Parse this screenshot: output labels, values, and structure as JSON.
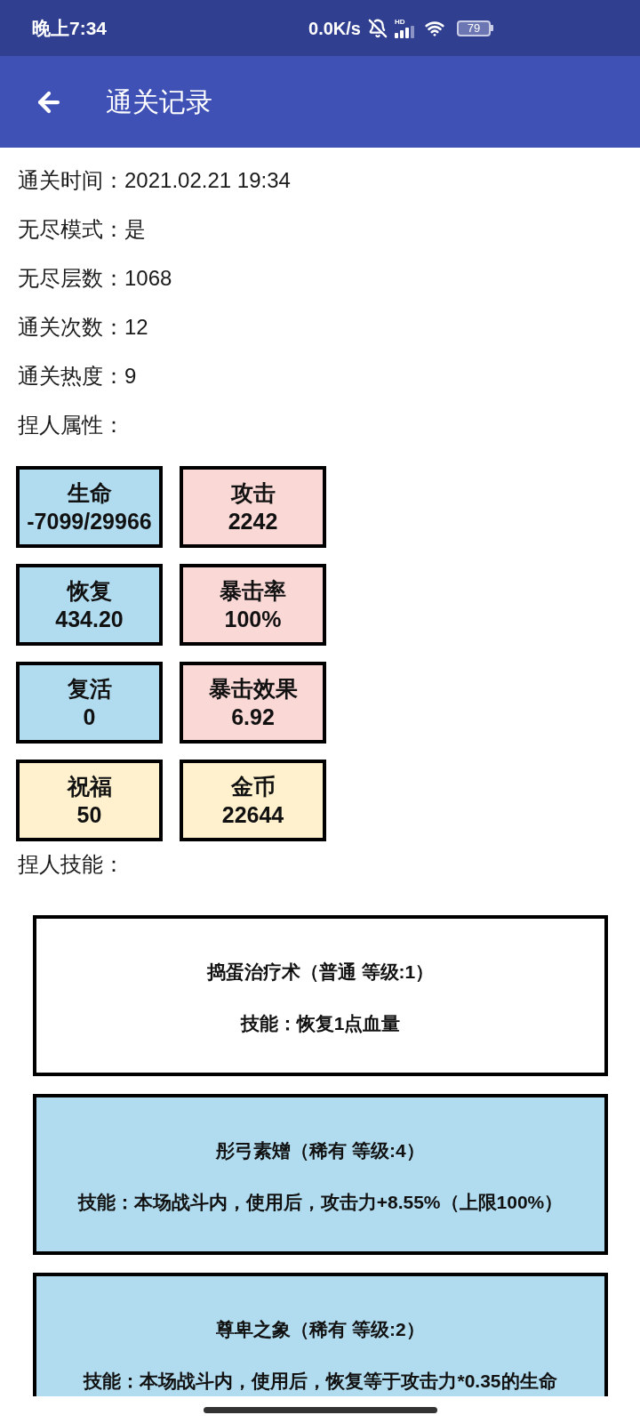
{
  "status_bar": {
    "time": "晚上7:34",
    "net_speed": "0.0K/s",
    "signal_label": "HD",
    "battery": "79"
  },
  "app_bar": {
    "title": "通关记录"
  },
  "records": [
    "通关时间：2021.02.21 19:34",
    "无尽模式：是",
    "无尽层数：1068",
    "通关次数：12",
    "通关热度：9"
  ],
  "attributes": {
    "heading": "捏人属性：",
    "tiles": [
      {
        "label": "生命",
        "value": "-7099/29966",
        "color": "#b1dcef"
      },
      {
        "label": "攻击",
        "value": "2242",
        "color": "#f9d8d6"
      },
      {
        "label": "恢复",
        "value": "434.20",
        "color": "#b1dcef"
      },
      {
        "label": "暴击率",
        "value": "100%",
        "color": "#f9d8d6"
      },
      {
        "label": "复活",
        "value": "0",
        "color": "#b1dcef"
      },
      {
        "label": "暴击效果",
        "value": "6.92",
        "color": "#f9d8d6"
      },
      {
        "label": "祝福",
        "value": "50",
        "color": "#fff1cd"
      },
      {
        "label": "金币",
        "value": "22644",
        "color": "#fff1cd"
      }
    ]
  },
  "skills": {
    "heading": "捏人技能：",
    "items": [
      {
        "title": "捣蛋治疗术（普通 等级:1）",
        "description": "技能：恢复1点血量",
        "color": "#ffffff"
      },
      {
        "title": "彤弓素矰（稀有 等级:4）",
        "description": "技能：本场战斗内，使用后，攻击力+8.55%（上限100%）",
        "color": "#b1dcef"
      },
      {
        "title": "尊卑之象（稀有 等级:2）",
        "description": "技能：本场战斗内，使用后，恢复等于攻击力*0.35的生命",
        "color": "#b1dcef"
      }
    ]
  }
}
